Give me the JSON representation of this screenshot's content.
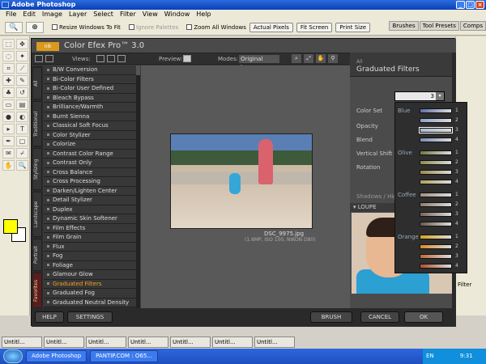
{
  "app": {
    "title": "Adobe Photoshop"
  },
  "menu": [
    "File",
    "Edit",
    "Image",
    "Layer",
    "Select",
    "Filter",
    "View",
    "Window",
    "Help"
  ],
  "options": {
    "resize_windows": "Resize Windows To Fit",
    "ignore_palettes": "Ignore Palettes",
    "zoom_all": "Zoom All Windows",
    "actual_pixels": "Actual Pixels",
    "fit_screen": "Fit Screen",
    "print_size": "Print Size"
  },
  "palette_tabs": [
    "Brushes",
    "Tool Presets",
    "Comps"
  ],
  "dialog": {
    "logo": "nik",
    "title": "Color Efex Pro™ 3.0",
    "views_label": "Views:",
    "preview_label": "Preview:",
    "modes_label": "Modes:",
    "modes_value": "Original Image"
  },
  "side_tabs": [
    "All",
    "Traditional",
    "Stylizing",
    "Landscape",
    "Portrait",
    "Favorites"
  ],
  "filters": [
    "B/W Conversion",
    "Bi-Color Filters",
    "Bi-Color User Defined",
    "Bleach Bypass",
    "Brilliance/Warmth",
    "Burnt Sienna",
    "Classical Soft Focus",
    "Color Stylizer",
    "Colorize",
    "Contrast Color Range",
    "Contrast Only",
    "Cross Balance",
    "Cross Processing",
    "Darken/Lighten Center",
    "Detail Stylizer",
    "Duplex",
    "Dynamic Skin Softener",
    "Film Effects",
    "Film Grain",
    "Flux",
    "Fog",
    "Foliage",
    "Glamour Glow",
    "Graduated Filters",
    "Graduated Fog",
    "Graduated Neutral Density"
  ],
  "active_filter": "Graduated Filters",
  "photo": {
    "filename": "DSC_9975.jpg",
    "meta": "(1.6MP, ISO 100, NIKON D80)"
  },
  "panel": {
    "all": "All",
    "filter_name": "Graduated Filters",
    "color_set": "Color Set",
    "color_set_value": "3",
    "opacity": "Opacity",
    "blend": "Blend",
    "vertical_shift": "Vertical Shift",
    "rotation": "Rotation",
    "shadows": "Shadows / Highli",
    "loupe": "LOUPE"
  },
  "color_sets": [
    {
      "group": "Blue",
      "colors": [
        "#5d6fa8",
        "#8aa3c9",
        "#a9bccf",
        "#7b8cb8"
      ]
    },
    {
      "group": "Olive",
      "colors": [
        "#6d7a43",
        "#8b8a4f",
        "#9a8a48",
        "#b0a060"
      ]
    },
    {
      "group": "Coffee",
      "colors": [
        "#a08f82",
        "#8e7a6c",
        "#7c6658",
        "#6b5648"
      ]
    },
    {
      "group": "Orange",
      "colors": [
        "#d6a317",
        "#d88a25",
        "#c0683a",
        "#b04e2c"
      ]
    }
  ],
  "buttons": {
    "help": "HELP",
    "settings": "SETTINGS",
    "brush": "BRUSH",
    "cancel": "CANCEL",
    "ok": "OK"
  },
  "right_panel": {
    "filter": "Filter"
  },
  "docs": [
    "Untitl...",
    "Untitl...",
    "Untitl...",
    "Untitl...",
    "Untitl...",
    "Untitl...",
    "Untitl..."
  ],
  "taskbar": {
    "photoshop": "Adobe Photoshop",
    "pantip": "PANTIP.COM : O65...",
    "lang": "EN",
    "time": "9:31"
  }
}
